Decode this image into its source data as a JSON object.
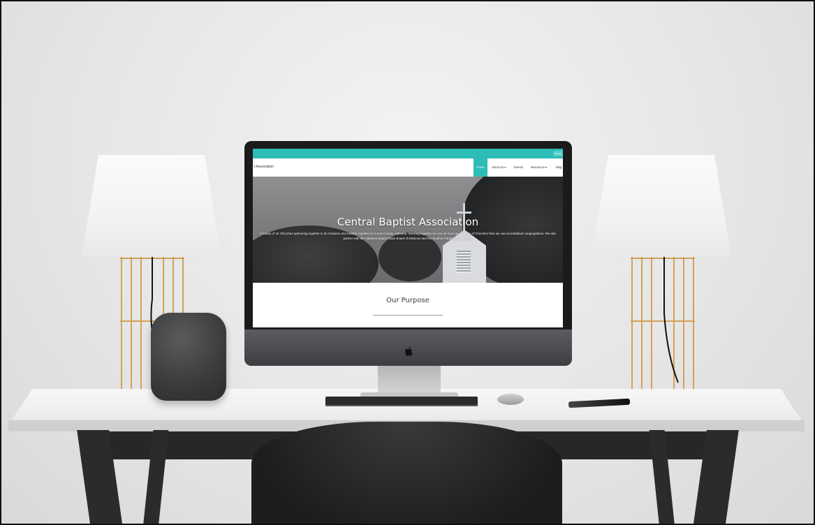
{
  "site": {
    "brand": "t Association",
    "search_label": "Search",
    "nav": [
      {
        "label": "Home"
      },
      {
        "label": "About Us ▾"
      },
      {
        "label": "Events"
      },
      {
        "label": "Resources ▾"
      },
      {
        "label": "Blog"
      }
    ],
    "hero": {
      "title": "Central Baptist Association",
      "text": "A Family of 22 Churches partnering together to do missions and ministry together in Coosa County, Alabama. Working together we can do more as a Family of Churches than we can as individual congregations. We also partner with the Alabama Baptist State Board of Missions and the Southern Baptist Convention."
    },
    "section": {
      "title": "Our Purpose"
    }
  },
  "colors": {
    "accent": "#2dbcb6",
    "hero_overlay": "#7a7b7d",
    "monitor_bezel": "#1b1b1c"
  },
  "icons": {
    "logo": "apple-logo-icon"
  }
}
